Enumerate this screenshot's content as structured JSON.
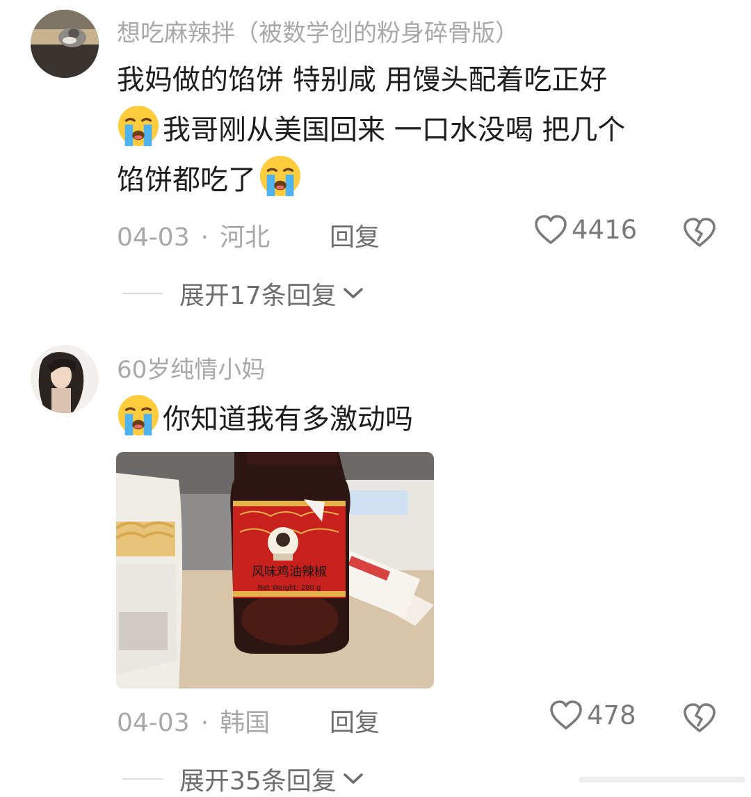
{
  "comments": [
    {
      "username": "想吃麻辣拌（被数学创的粉身碎骨版）",
      "lines": [
        "我妈做的馅饼 特别咸 用馒头配着吃正好",
        "我哥刚从美国回来 一口水没喝 把几个",
        "馅饼都吃了"
      ],
      "date": "04-03",
      "separator": "·",
      "location": "河北",
      "reply_label": "回复",
      "likes": "4416",
      "expand_label": "展开17条回复"
    },
    {
      "username": "60岁纯情小妈",
      "lines": [
        "你知道我有多激动吗"
      ],
      "photo_label_text": "风味鸡油辣椒",
      "photo_weight_text": "Net Weight: 280 g",
      "date": "04-03",
      "separator": "·",
      "location": "韩国",
      "reply_label": "回复",
      "likes": "478",
      "expand_label": "展开35条回复"
    }
  ],
  "icons": {
    "crying_emoji": "loudly-crying-face-icon",
    "like": "heart-icon",
    "dislike": "broken-heart-icon",
    "expand": "chevron-down-icon"
  },
  "colors": {
    "text": "#1d1d1d",
    "muted": "#a8a8a8",
    "secondary": "#6d6d6d",
    "emoji_yellow": "#ffcc3d",
    "tear_blue": "#4fb3ef"
  }
}
